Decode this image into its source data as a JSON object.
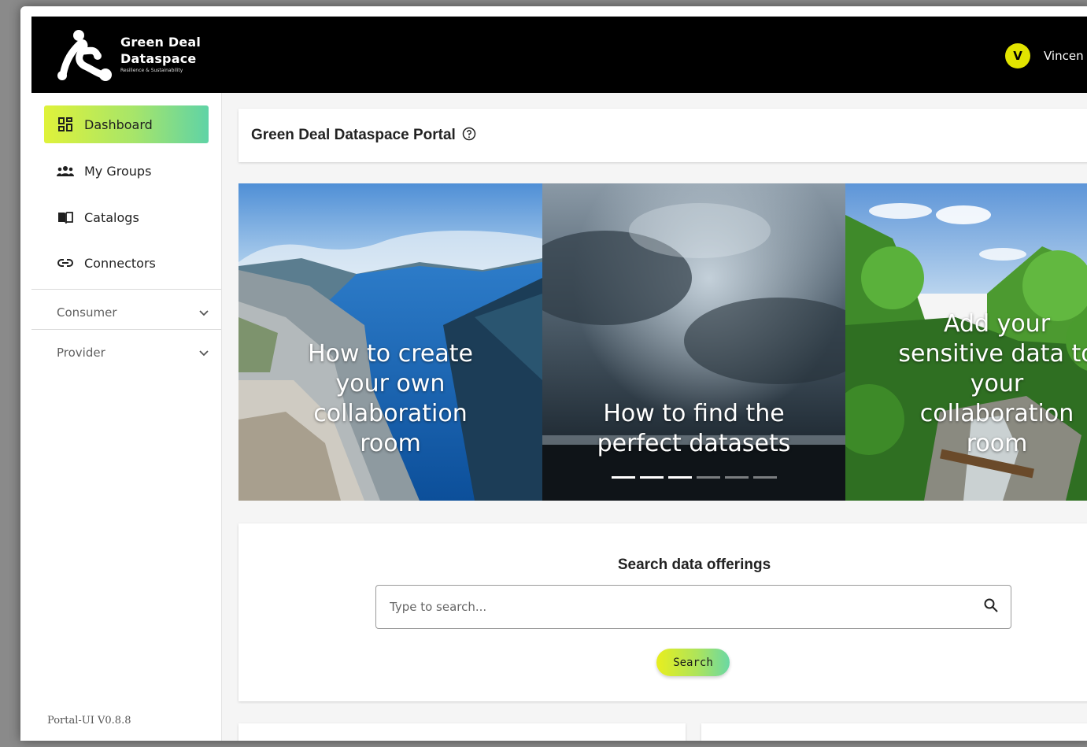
{
  "header": {
    "brand_line1": "Green Deal",
    "brand_line2": "Dataspace",
    "brand_tagline": "Resilience & Sustainability",
    "user_initial": "V",
    "user_name": "Vincen"
  },
  "sidebar": {
    "items": [
      {
        "label": "Dashboard",
        "icon": "dashboard-icon",
        "active": true
      },
      {
        "label": "My Groups",
        "icon": "groups-icon"
      },
      {
        "label": "Catalogs",
        "icon": "book-icon"
      },
      {
        "label": "Connectors",
        "icon": "link-icon"
      }
    ],
    "sections": [
      {
        "label": "Consumer",
        "icon": "chevron-down-icon"
      },
      {
        "label": "Provider",
        "icon": "chevron-down-icon"
      }
    ],
    "version": "Portal-UI V0.8.8"
  },
  "main": {
    "title": "Green Deal Dataspace Portal",
    "title_icon": "help-circle-icon"
  },
  "carousel": {
    "slides": [
      {
        "lines": [
          "How to create",
          "your own",
          "collaboration",
          "room"
        ]
      },
      {
        "lines": [
          "How to find the",
          "perfect datasets"
        ]
      },
      {
        "lines": [
          "Add your",
          "sensitive data to",
          "your",
          "collaboration",
          "room"
        ]
      }
    ],
    "indicators_total": 6,
    "indicators_active": 3
  },
  "search": {
    "title": "Search data offerings",
    "placeholder": "Type to search...",
    "button_label": "Search",
    "icon": "search-icon"
  },
  "colors": {
    "accent_yellow": "#e2e400",
    "gradient_start": "#dff23a",
    "gradient_end": "#5fd3a6",
    "header_bg": "#000000"
  }
}
